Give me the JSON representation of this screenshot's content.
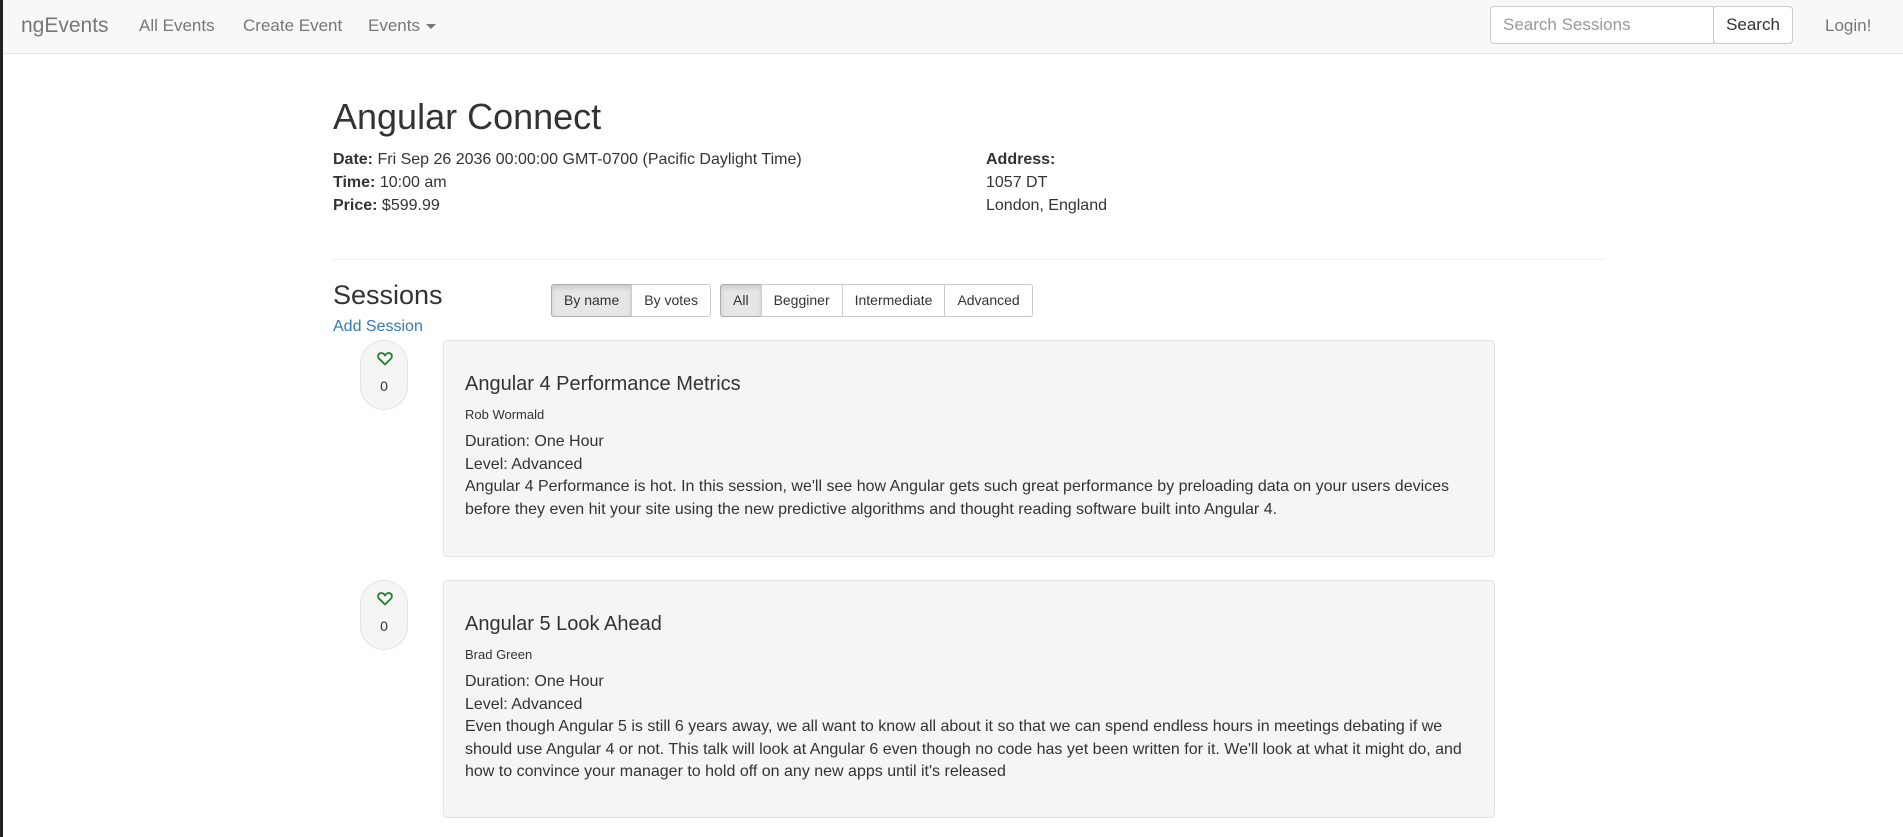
{
  "nav": {
    "brand": "ngEvents",
    "all_events": "All Events",
    "create_event": "Create Event",
    "events_dropdown": "Events",
    "search_placeholder": "Search Sessions",
    "search_button": "Search",
    "login": "Login!"
  },
  "event": {
    "title": "Angular Connect",
    "date_label": "Date:",
    "date_value": "Fri Sep 26 2036 00:00:00 GMT-0700 (Pacific Daylight Time)",
    "time_label": "Time:",
    "time_value": "10:00 am",
    "price_label": "Price:",
    "price_value": "$599.99",
    "address_label": "Address:",
    "address_line1": "1057 DT",
    "address_line2": "London, England"
  },
  "sessions": {
    "title": "Sessions",
    "add_session": "Add Session",
    "sort_buttons": [
      {
        "label": "By name",
        "active": true
      },
      {
        "label": "By votes",
        "active": false
      }
    ],
    "filter_buttons": [
      {
        "label": "All",
        "active": true
      },
      {
        "label": "Begginer",
        "active": false
      },
      {
        "label": "Intermediate",
        "active": false
      },
      {
        "label": "Advanced",
        "active": false
      }
    ],
    "items": [
      {
        "votes": "0",
        "name": "Angular 4 Performance Metrics",
        "presenter": "Rob Wormald",
        "duration": "Duration: One Hour",
        "level": "Level: Advanced",
        "abstract": "Angular 4 Performance is hot. In this session, we'll see how Angular gets such great performance by preloading data on your users devices before they even hit your site using the new predictive algorithms and thought reading software built into Angular 4."
      },
      {
        "votes": "0",
        "name": "Angular 5 Look Ahead",
        "presenter": "Brad Green",
        "duration": "Duration: One Hour",
        "level": "Level: Advanced",
        "abstract": "Even though Angular 5 is still 6 years away, we all want to know all about it so that we can spend endless hours in meetings debating if we should use Angular 4 or not. This talk will look at Angular 6 even though no code has yet been written for it. We'll look at what it might do, and how to convince your manager to hold off on any new apps until it's released"
      }
    ]
  },
  "colors": {
    "heart": "#2a7a2a",
    "link": "#337ab7",
    "navbar_bg": "#f8f8f8",
    "well_bg": "#f5f5f5"
  },
  "icons": {
    "heart": "heart-icon",
    "caret": "caret-down-icon"
  }
}
